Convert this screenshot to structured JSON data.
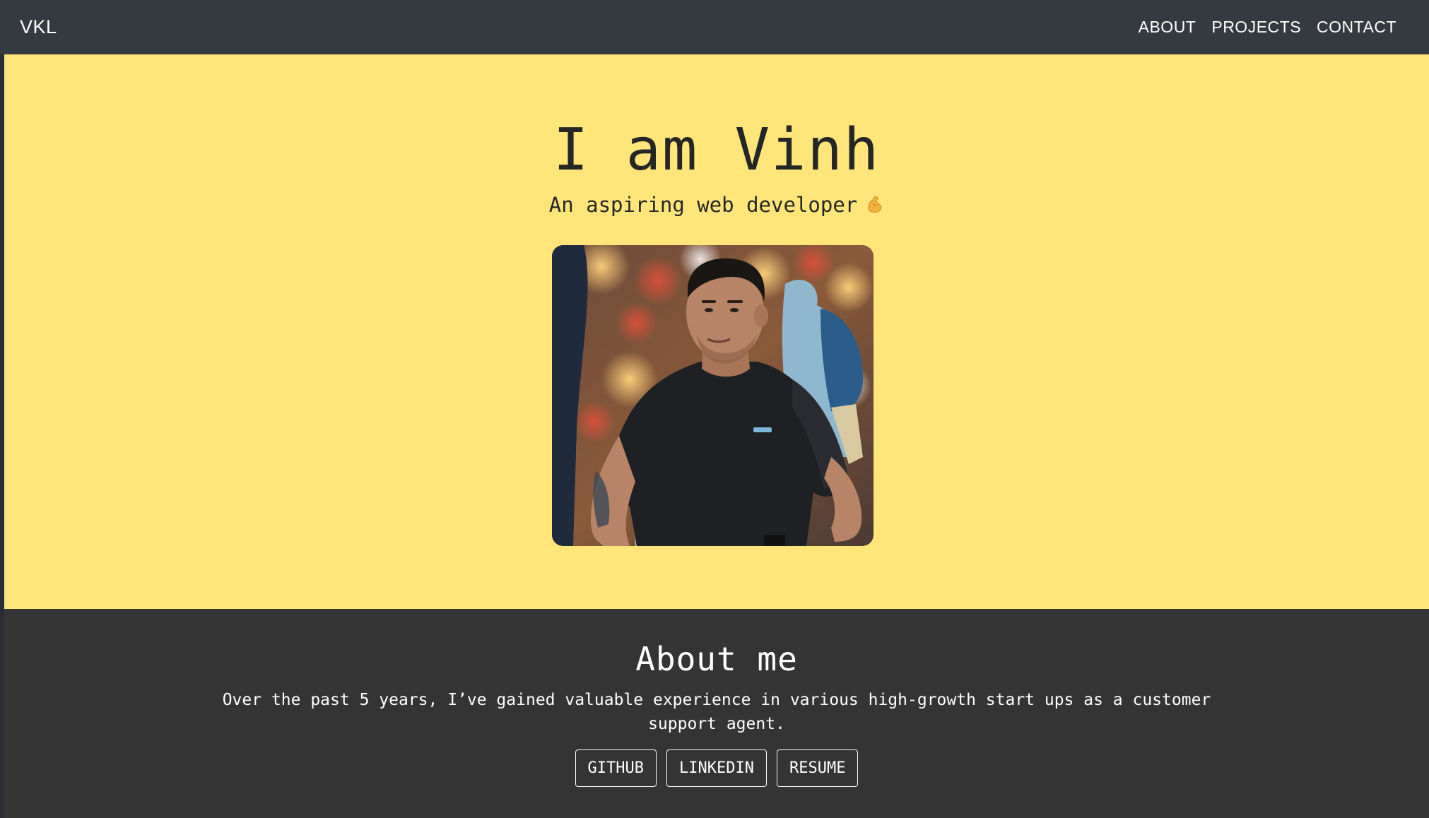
{
  "navbar": {
    "brand": "VKL",
    "links": [
      "ABOUT",
      "PROJECTS",
      "CONTACT"
    ]
  },
  "hero": {
    "title": "I am Vinh",
    "subtitle": "An aspiring web developer",
    "emoji_icon": "flexed-biceps-icon"
  },
  "about": {
    "title": "About me",
    "text": "Over the past 5 years, I’ve gained valuable experience in various high-growth start ups as a customer support agent.",
    "buttons": [
      "GITHUB",
      "LINKEDIN",
      "RESUME"
    ]
  },
  "colors": {
    "navbar": "#343a40",
    "hero_bg": "#ffe57a",
    "about_bg": "#343434",
    "text_dark": "#262626",
    "text_light": "#ffffff"
  }
}
